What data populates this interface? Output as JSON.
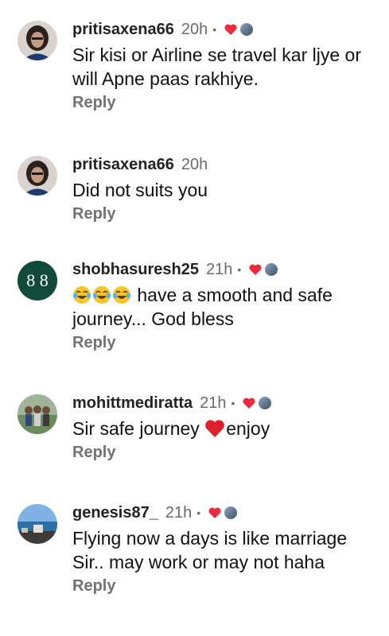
{
  "comments": [
    {
      "username": "pritisaxena66",
      "time": "20h",
      "separator": "•",
      "liked_by_author": true,
      "text": "Sir kisi or Airline se travel kar ljye or will Apne paas rakhiye.",
      "reply": "Reply",
      "avatar": "woman-portrait-avatar"
    },
    {
      "username": "pritisaxena66",
      "time": "20h",
      "separator": "",
      "liked_by_author": false,
      "text": "Did not suits you",
      "reply": "Reply",
      "avatar": "woman-portrait-avatar"
    },
    {
      "username": "shobhasuresh25",
      "time": "21h",
      "separator": "•",
      "liked_by_author": true,
      "emojis": [
        "😂",
        "😂",
        "😂"
      ],
      "text": "have a smooth and safe journey... God bless",
      "reply": "Reply",
      "avatar": "eight-logo-avatar"
    },
    {
      "username": "mohittmediratta",
      "time": "21h",
      "separator": "•",
      "liked_by_author": true,
      "text_before": "Sir safe journey ",
      "inline_emoji": "❤️",
      "text_after": "enjoy",
      "reply": "Reply",
      "avatar": "group-photo-avatar"
    },
    {
      "username": "genesis87_",
      "time": "21h",
      "separator": "•",
      "liked_by_author": true,
      "text": "Flying now a days is like marriage Sir.. may work or may not haha",
      "reply": "Reply",
      "avatar": "seaside-photo-avatar"
    }
  ],
  "colors": {
    "heart": "#ed2b3d",
    "muted": "#727272",
    "text": "#111111"
  },
  "avatar_logo_text": "8 8"
}
